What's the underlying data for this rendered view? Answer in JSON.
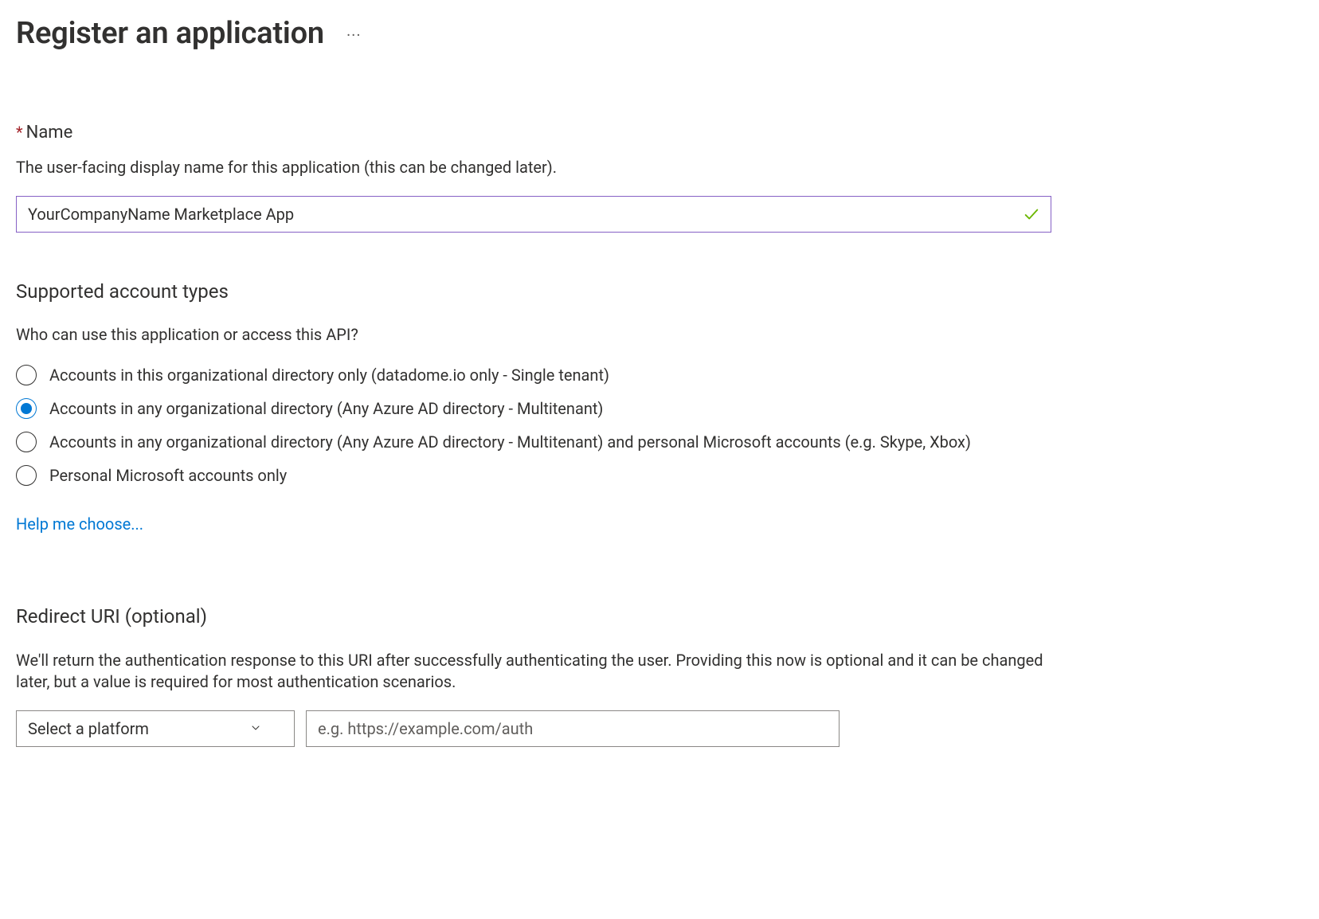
{
  "header": {
    "title": "Register an application"
  },
  "name_section": {
    "label": "Name",
    "description": "The user-facing display name for this application (this can be changed later).",
    "value": "YourCompanyName Marketplace App"
  },
  "account_types": {
    "heading": "Supported account types",
    "question": "Who can use this application or access this API?",
    "options": [
      {
        "label": "Accounts in this organizational directory only (datadome.io only - Single tenant)",
        "selected": false
      },
      {
        "label": "Accounts in any organizational directory (Any Azure AD directory - Multitenant)",
        "selected": true
      },
      {
        "label": "Accounts in any organizational directory (Any Azure AD directory - Multitenant) and personal Microsoft accounts (e.g. Skype, Xbox)",
        "selected": false
      },
      {
        "label": "Personal Microsoft accounts only",
        "selected": false
      }
    ],
    "help_link": "Help me choose..."
  },
  "redirect": {
    "heading": "Redirect URI (optional)",
    "description": "We'll return the authentication response to this URI after successfully authenticating the user. Providing this now is optional and it can be changed later, but a value is required for most authentication scenarios.",
    "platform_placeholder": "Select a platform",
    "uri_placeholder": "e.g. https://example.com/auth"
  }
}
